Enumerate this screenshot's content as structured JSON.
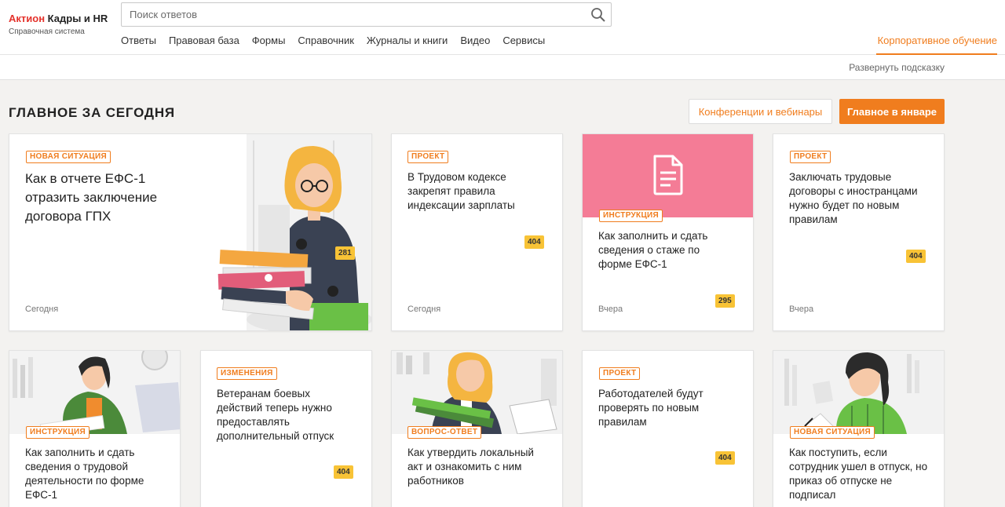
{
  "logo": {
    "brand": "Актион",
    "product": "Кадры и HR",
    "subtitle": "Справочная система"
  },
  "search": {
    "placeholder": "Поиск ответов",
    "value": ""
  },
  "nav": [
    "Ответы",
    "Правовая база",
    "Формы",
    "Справочник",
    "Журналы и книги",
    "Видео",
    "Сервисы"
  ],
  "corp_link": "Корпоративное обучение",
  "hint_toggle": "Развернуть подсказку",
  "section": {
    "title": "ГЛАВНОЕ ЗА СЕГОДНЯ",
    "btn_conferences": "Конференции и вебинары",
    "btn_january": "Главное в январе"
  },
  "cards": [
    {
      "tag": "НОВАЯ СИТУАЦИЯ",
      "title": "Как в отчете ЕФС-1 отразить заключение договора ГПХ",
      "date": "Сегодня",
      "count": "281"
    },
    {
      "tag": "ПРОЕКТ",
      "title": "В Трудовом кодексе закрепят правила индексации зарплаты",
      "date": "Сегодня",
      "count": "404"
    },
    {
      "tag": "ИНСТРУКЦИЯ",
      "title": "Как заполнить и сдать сведения о стаже по форме ЕФС-1",
      "date": "Вчера",
      "count": "295"
    },
    {
      "tag": "ПРОЕКТ",
      "title": "Заключать трудовые договоры с иностранцами нужно будет по новым правилам",
      "date": "Вчера",
      "count": "404"
    },
    {
      "tag": "ИНСТРУКЦИЯ",
      "title": "Как заполнить и сдать сведения о трудовой деятельности по форме ЕФС-1",
      "date": "",
      "count": ""
    },
    {
      "tag": "ИЗМЕНЕНИЯ",
      "title": "Ветеранам боевых действий теперь нужно предоставлять дополнительный отпуск",
      "date": "",
      "count": "404"
    },
    {
      "tag": "ВОПРОС-ОТВЕТ",
      "title": "Как утвердить локальный акт и ознакомить с ним работников",
      "date": "",
      "count": ""
    },
    {
      "tag": "ПРОЕКТ",
      "title": "Работодателей будут проверять по новым правилам",
      "date": "",
      "count": "404"
    },
    {
      "tag": "НОВАЯ СИТУАЦИЯ",
      "title": "Как поступить, если сотрудник ушел в отпуск, но приказ об отпуске не подписал",
      "date": "",
      "count": ""
    }
  ],
  "colors": {
    "accent": "#f07d1e",
    "badge": "#f8c336",
    "pink_header": "#f47c96",
    "logo_red": "#e4322b"
  },
  "icons": [
    "search-icon",
    "document-icon"
  ]
}
